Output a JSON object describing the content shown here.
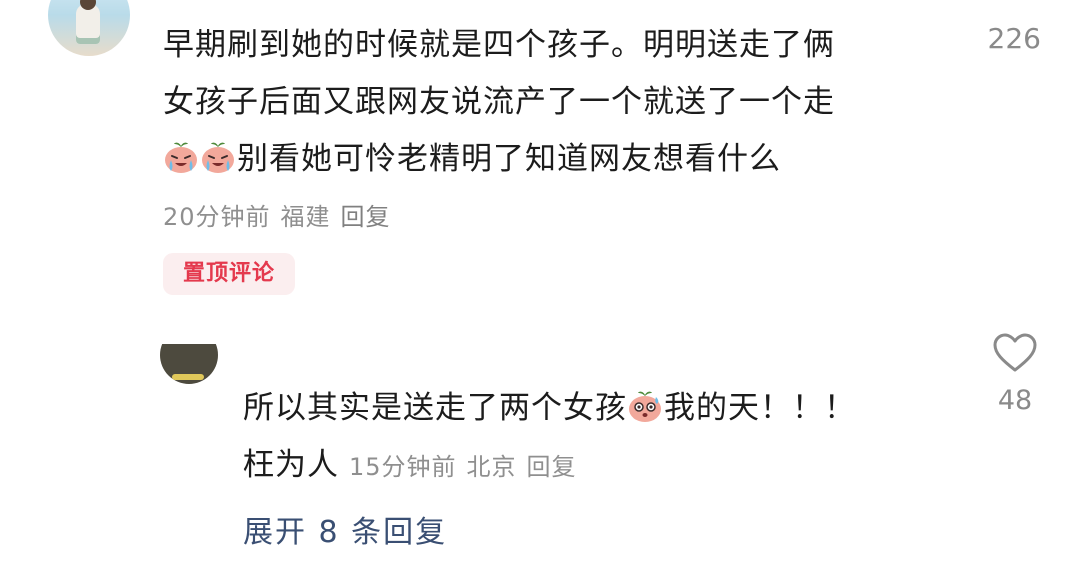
{
  "comment": {
    "text_line1": "早期刷到她的时候就是四个孩子。明明送走了俩",
    "text_line2": "女孩子后面又跟网友说流产了一个就送了一个走",
    "text_line3": "别看她可怜老精明了知道网友想看什么",
    "time": "20分钟前",
    "location": "福建",
    "reply_label": "回复",
    "badge": "置顶评论",
    "count": "226"
  },
  "reply": {
    "text_part1": "所以其实是送走了两个女孩",
    "text_part2": "我的天！！！",
    "text_line2": "枉为人",
    "time": "15分钟前",
    "location": "北京",
    "reply_label": "回复",
    "like_count": "48"
  },
  "expand": {
    "label": "展开 8 条回复"
  },
  "icons": {
    "heart": "heart-outline-icon",
    "cry_emoji": "crying-peach-emoji",
    "shock_emoji": "shocked-peach-emoji"
  }
}
